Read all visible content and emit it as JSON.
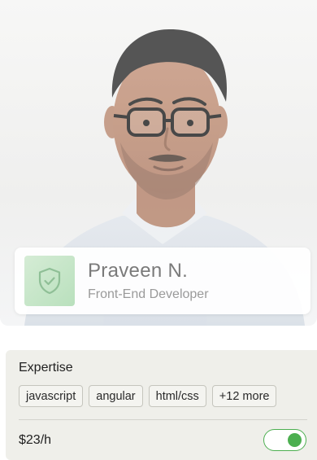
{
  "profile": {
    "name": "Praveen N.",
    "role": "Front-End Developer",
    "photo_icon": "person-photo",
    "badge_icon": "shield-check-icon"
  },
  "expertise": {
    "title": "Expertise",
    "tags": [
      "javascript",
      "angular",
      "html/css",
      "+12 more"
    ],
    "rate": "$23/h",
    "available": true
  },
  "colors": {
    "accent": "#4caf50",
    "badge_bg": "#c9e7cb",
    "card_bg": "#efefea"
  }
}
